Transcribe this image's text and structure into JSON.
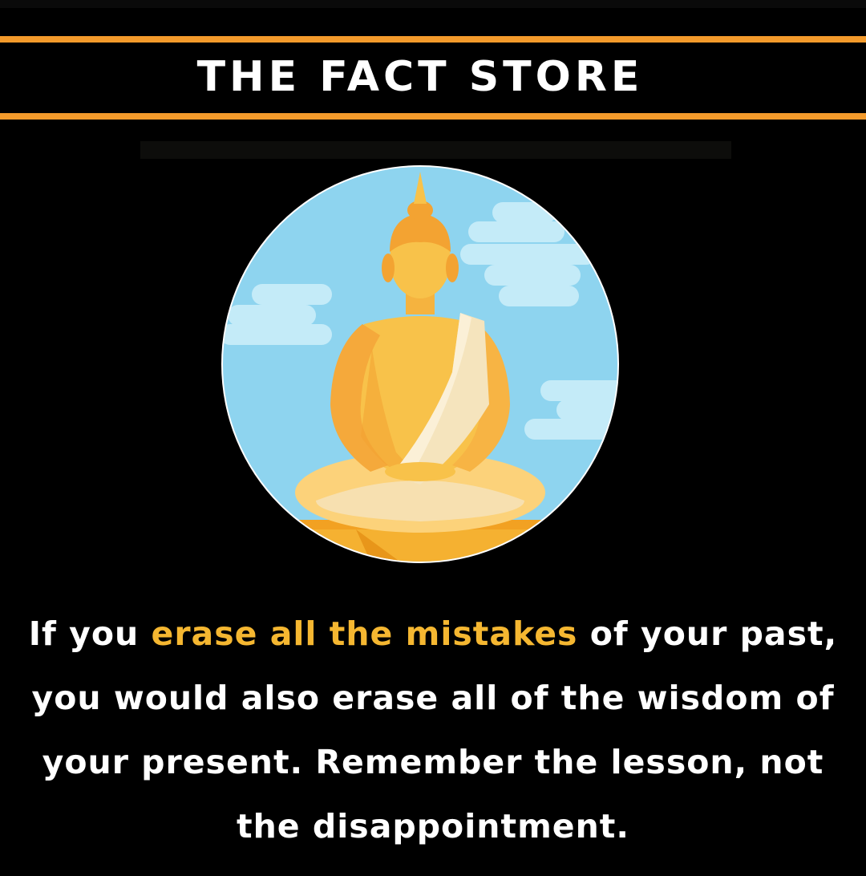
{
  "header": {
    "title": "THE FACT STORE"
  },
  "illustration": {
    "icon": "meditating-buddha-icon"
  },
  "quote": {
    "part1": "If you ",
    "highlight": "erase all the mistakes",
    "part2": " of your past, you would also erase all of the wisdom of your present. Remember the lesson, not the disappointment."
  },
  "colors": {
    "background": "#000000",
    "accent_orange": "#f39a2b",
    "highlight_yellow": "#f5b731",
    "text_white": "#ffffff",
    "sky_blue": "#8ed4ef"
  }
}
